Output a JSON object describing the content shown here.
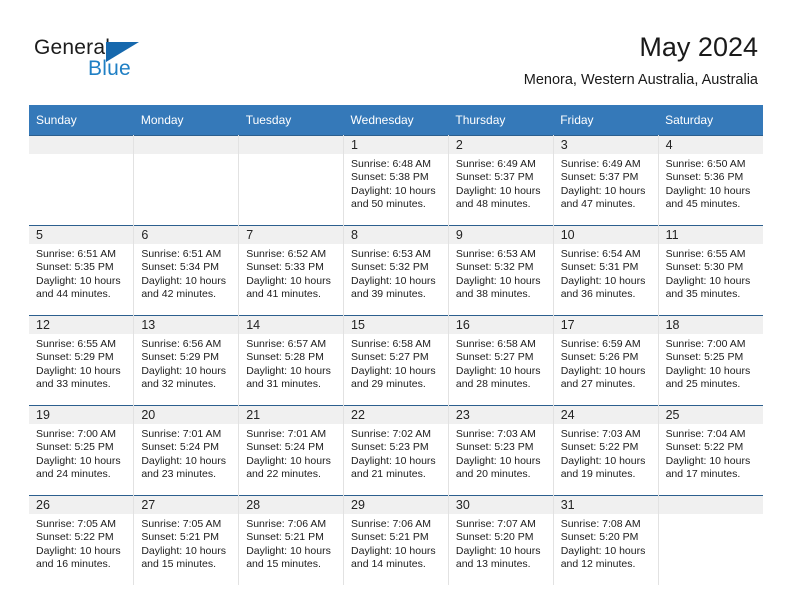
{
  "logo": {
    "word1": "General",
    "word2": "Blue",
    "triangle_color": "#1668ad",
    "blue_text_color": "#1f7fc4"
  },
  "header": {
    "title": "May 2024",
    "subtitle": "Menora, Western Australia, Australia"
  },
  "theme": {
    "header_bg": "#3579b9",
    "header_text": "#ffffff",
    "daynum_band_bg": "#f0f0f0",
    "row_divider": "#2c5f8e",
    "column_divider": "#e2e2e2"
  },
  "weekdays": [
    "Sunday",
    "Monday",
    "Tuesday",
    "Wednesday",
    "Thursday",
    "Friday",
    "Saturday"
  ],
  "labels": {
    "sunrise_prefix": "Sunrise:",
    "sunset_prefix": "Sunset:",
    "daylight_prefix": "Daylight:"
  },
  "weeks": [
    [
      {
        "day": "",
        "sunrise": "",
        "sunset": "",
        "daylight_line1": "",
        "daylight_line2": ""
      },
      {
        "day": "",
        "sunrise": "",
        "sunset": "",
        "daylight_line1": "",
        "daylight_line2": ""
      },
      {
        "day": "",
        "sunrise": "",
        "sunset": "",
        "daylight_line1": "",
        "daylight_line2": ""
      },
      {
        "day": "1",
        "sunrise": "Sunrise: 6:48 AM",
        "sunset": "Sunset: 5:38 PM",
        "daylight_line1": "Daylight: 10 hours",
        "daylight_line2": "and 50 minutes."
      },
      {
        "day": "2",
        "sunrise": "Sunrise: 6:49 AM",
        "sunset": "Sunset: 5:37 PM",
        "daylight_line1": "Daylight: 10 hours",
        "daylight_line2": "and 48 minutes."
      },
      {
        "day": "3",
        "sunrise": "Sunrise: 6:49 AM",
        "sunset": "Sunset: 5:37 PM",
        "daylight_line1": "Daylight: 10 hours",
        "daylight_line2": "and 47 minutes."
      },
      {
        "day": "4",
        "sunrise": "Sunrise: 6:50 AM",
        "sunset": "Sunset: 5:36 PM",
        "daylight_line1": "Daylight: 10 hours",
        "daylight_line2": "and 45 minutes."
      }
    ],
    [
      {
        "day": "5",
        "sunrise": "Sunrise: 6:51 AM",
        "sunset": "Sunset: 5:35 PM",
        "daylight_line1": "Daylight: 10 hours",
        "daylight_line2": "and 44 minutes."
      },
      {
        "day": "6",
        "sunrise": "Sunrise: 6:51 AM",
        "sunset": "Sunset: 5:34 PM",
        "daylight_line1": "Daylight: 10 hours",
        "daylight_line2": "and 42 minutes."
      },
      {
        "day": "7",
        "sunrise": "Sunrise: 6:52 AM",
        "sunset": "Sunset: 5:33 PM",
        "daylight_line1": "Daylight: 10 hours",
        "daylight_line2": "and 41 minutes."
      },
      {
        "day": "8",
        "sunrise": "Sunrise: 6:53 AM",
        "sunset": "Sunset: 5:32 PM",
        "daylight_line1": "Daylight: 10 hours",
        "daylight_line2": "and 39 minutes."
      },
      {
        "day": "9",
        "sunrise": "Sunrise: 6:53 AM",
        "sunset": "Sunset: 5:32 PM",
        "daylight_line1": "Daylight: 10 hours",
        "daylight_line2": "and 38 minutes."
      },
      {
        "day": "10",
        "sunrise": "Sunrise: 6:54 AM",
        "sunset": "Sunset: 5:31 PM",
        "daylight_line1": "Daylight: 10 hours",
        "daylight_line2": "and 36 minutes."
      },
      {
        "day": "11",
        "sunrise": "Sunrise: 6:55 AM",
        "sunset": "Sunset: 5:30 PM",
        "daylight_line1": "Daylight: 10 hours",
        "daylight_line2": "and 35 minutes."
      }
    ],
    [
      {
        "day": "12",
        "sunrise": "Sunrise: 6:55 AM",
        "sunset": "Sunset: 5:29 PM",
        "daylight_line1": "Daylight: 10 hours",
        "daylight_line2": "and 33 minutes."
      },
      {
        "day": "13",
        "sunrise": "Sunrise: 6:56 AM",
        "sunset": "Sunset: 5:29 PM",
        "daylight_line1": "Daylight: 10 hours",
        "daylight_line2": "and 32 minutes."
      },
      {
        "day": "14",
        "sunrise": "Sunrise: 6:57 AM",
        "sunset": "Sunset: 5:28 PM",
        "daylight_line1": "Daylight: 10 hours",
        "daylight_line2": "and 31 minutes."
      },
      {
        "day": "15",
        "sunrise": "Sunrise: 6:58 AM",
        "sunset": "Sunset: 5:27 PM",
        "daylight_line1": "Daylight: 10 hours",
        "daylight_line2": "and 29 minutes."
      },
      {
        "day": "16",
        "sunrise": "Sunrise: 6:58 AM",
        "sunset": "Sunset: 5:27 PM",
        "daylight_line1": "Daylight: 10 hours",
        "daylight_line2": "and 28 minutes."
      },
      {
        "day": "17",
        "sunrise": "Sunrise: 6:59 AM",
        "sunset": "Sunset: 5:26 PM",
        "daylight_line1": "Daylight: 10 hours",
        "daylight_line2": "and 27 minutes."
      },
      {
        "day": "18",
        "sunrise": "Sunrise: 7:00 AM",
        "sunset": "Sunset: 5:25 PM",
        "daylight_line1": "Daylight: 10 hours",
        "daylight_line2": "and 25 minutes."
      }
    ],
    [
      {
        "day": "19",
        "sunrise": "Sunrise: 7:00 AM",
        "sunset": "Sunset: 5:25 PM",
        "daylight_line1": "Daylight: 10 hours",
        "daylight_line2": "and 24 minutes."
      },
      {
        "day": "20",
        "sunrise": "Sunrise: 7:01 AM",
        "sunset": "Sunset: 5:24 PM",
        "daylight_line1": "Daylight: 10 hours",
        "daylight_line2": "and 23 minutes."
      },
      {
        "day": "21",
        "sunrise": "Sunrise: 7:01 AM",
        "sunset": "Sunset: 5:24 PM",
        "daylight_line1": "Daylight: 10 hours",
        "daylight_line2": "and 22 minutes."
      },
      {
        "day": "22",
        "sunrise": "Sunrise: 7:02 AM",
        "sunset": "Sunset: 5:23 PM",
        "daylight_line1": "Daylight: 10 hours",
        "daylight_line2": "and 21 minutes."
      },
      {
        "day": "23",
        "sunrise": "Sunrise: 7:03 AM",
        "sunset": "Sunset: 5:23 PM",
        "daylight_line1": "Daylight: 10 hours",
        "daylight_line2": "and 20 minutes."
      },
      {
        "day": "24",
        "sunrise": "Sunrise: 7:03 AM",
        "sunset": "Sunset: 5:22 PM",
        "daylight_line1": "Daylight: 10 hours",
        "daylight_line2": "and 19 minutes."
      },
      {
        "day": "25",
        "sunrise": "Sunrise: 7:04 AM",
        "sunset": "Sunset: 5:22 PM",
        "daylight_line1": "Daylight: 10 hours",
        "daylight_line2": "and 17 minutes."
      }
    ],
    [
      {
        "day": "26",
        "sunrise": "Sunrise: 7:05 AM",
        "sunset": "Sunset: 5:22 PM",
        "daylight_line1": "Daylight: 10 hours",
        "daylight_line2": "and 16 minutes."
      },
      {
        "day": "27",
        "sunrise": "Sunrise: 7:05 AM",
        "sunset": "Sunset: 5:21 PM",
        "daylight_line1": "Daylight: 10 hours",
        "daylight_line2": "and 15 minutes."
      },
      {
        "day": "28",
        "sunrise": "Sunrise: 7:06 AM",
        "sunset": "Sunset: 5:21 PM",
        "daylight_line1": "Daylight: 10 hours",
        "daylight_line2": "and 15 minutes."
      },
      {
        "day": "29",
        "sunrise": "Sunrise: 7:06 AM",
        "sunset": "Sunset: 5:21 PM",
        "daylight_line1": "Daylight: 10 hours",
        "daylight_line2": "and 14 minutes."
      },
      {
        "day": "30",
        "sunrise": "Sunrise: 7:07 AM",
        "sunset": "Sunset: 5:20 PM",
        "daylight_line1": "Daylight: 10 hours",
        "daylight_line2": "and 13 minutes."
      },
      {
        "day": "31",
        "sunrise": "Sunrise: 7:08 AM",
        "sunset": "Sunset: 5:20 PM",
        "daylight_line1": "Daylight: 10 hours",
        "daylight_line2": "and 12 minutes."
      },
      {
        "day": "",
        "sunrise": "",
        "sunset": "",
        "daylight_line1": "",
        "daylight_line2": ""
      }
    ]
  ]
}
